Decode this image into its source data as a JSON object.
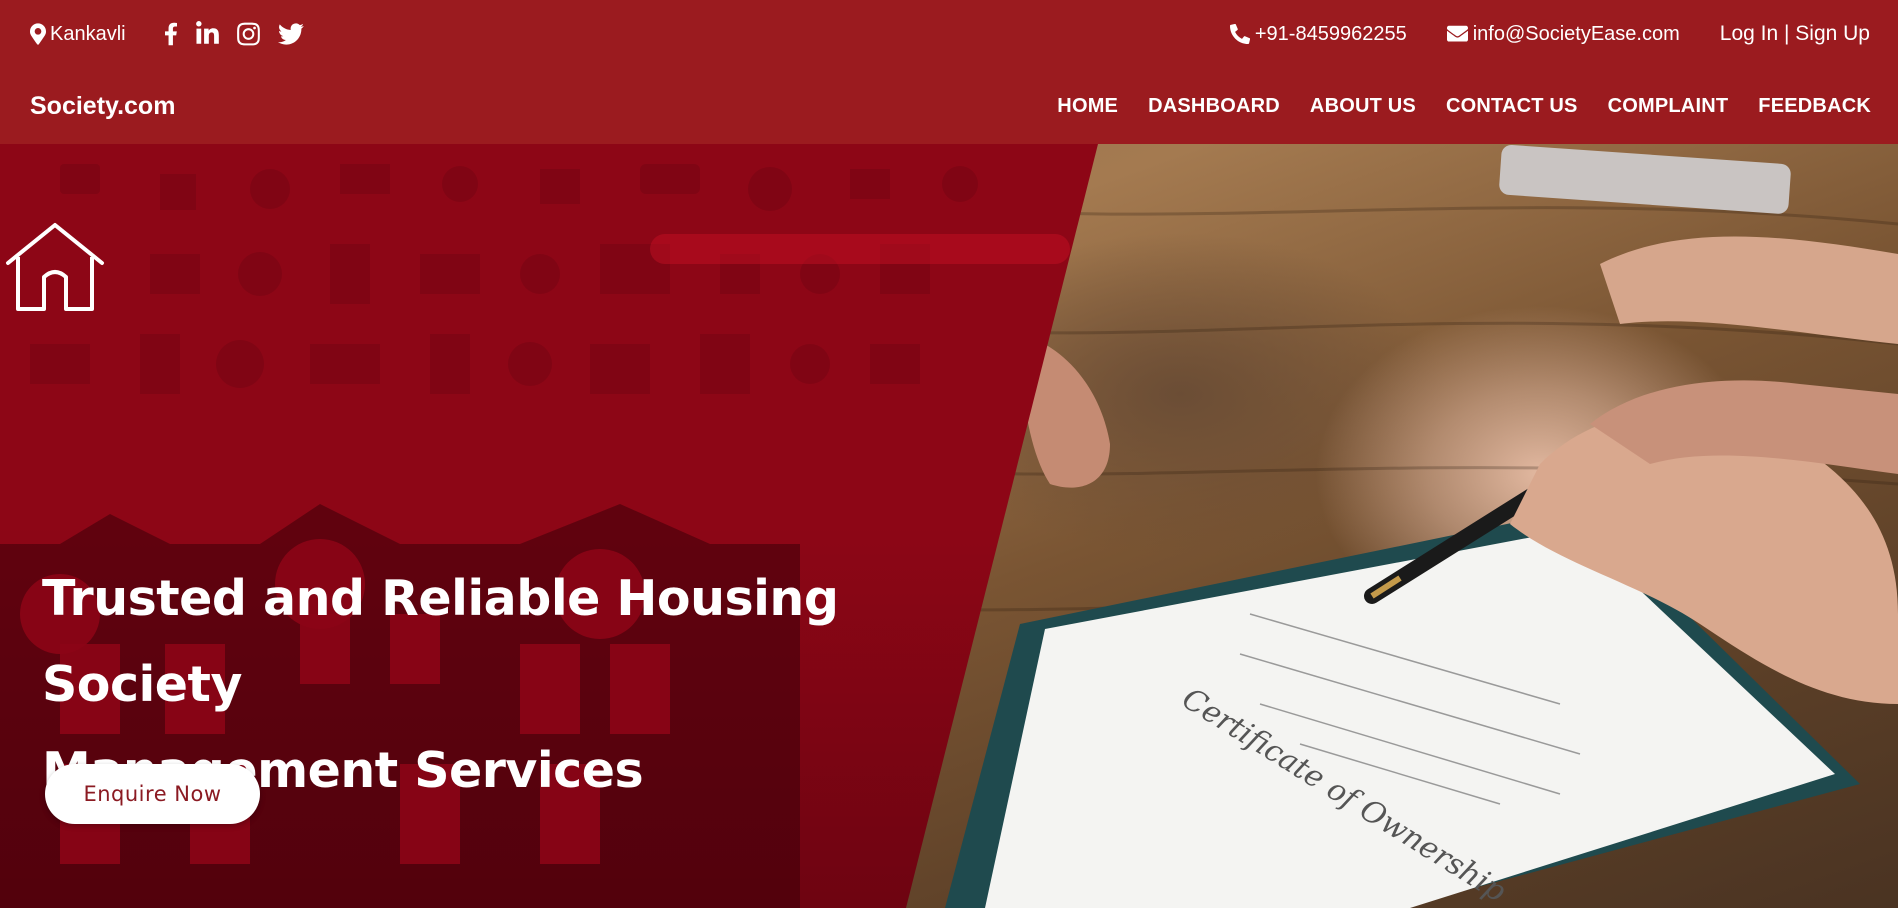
{
  "topbar": {
    "location": "Kankavli",
    "phone": "+91-8459962255",
    "email": "info@SocietyEase.com",
    "auth": {
      "login": "Log In",
      "separator": " | ",
      "signup": "Sign Up"
    },
    "social_icons": [
      "facebook-icon",
      "linkedin-icon",
      "instagram-icon",
      "twitter-icon"
    ]
  },
  "navbar": {
    "brand": "Society.com",
    "items": [
      {
        "label": "HOME"
      },
      {
        "label": "DASHBOARD"
      },
      {
        "label": "ABOUT US"
      },
      {
        "label": "CONTACT US"
      },
      {
        "label": "COMPLAINT"
      },
      {
        "label": "FEEDBACK"
      }
    ]
  },
  "hero": {
    "title_line1": "Trusted and Reliable Housing Society",
    "title_line2": "Management Services",
    "cta_label": "Enquire Now",
    "icon": "house-icon"
  },
  "colors": {
    "header_bg": "#9b1b1f",
    "hero_panel": "#8d0616",
    "cta_text": "#8b1a22"
  }
}
